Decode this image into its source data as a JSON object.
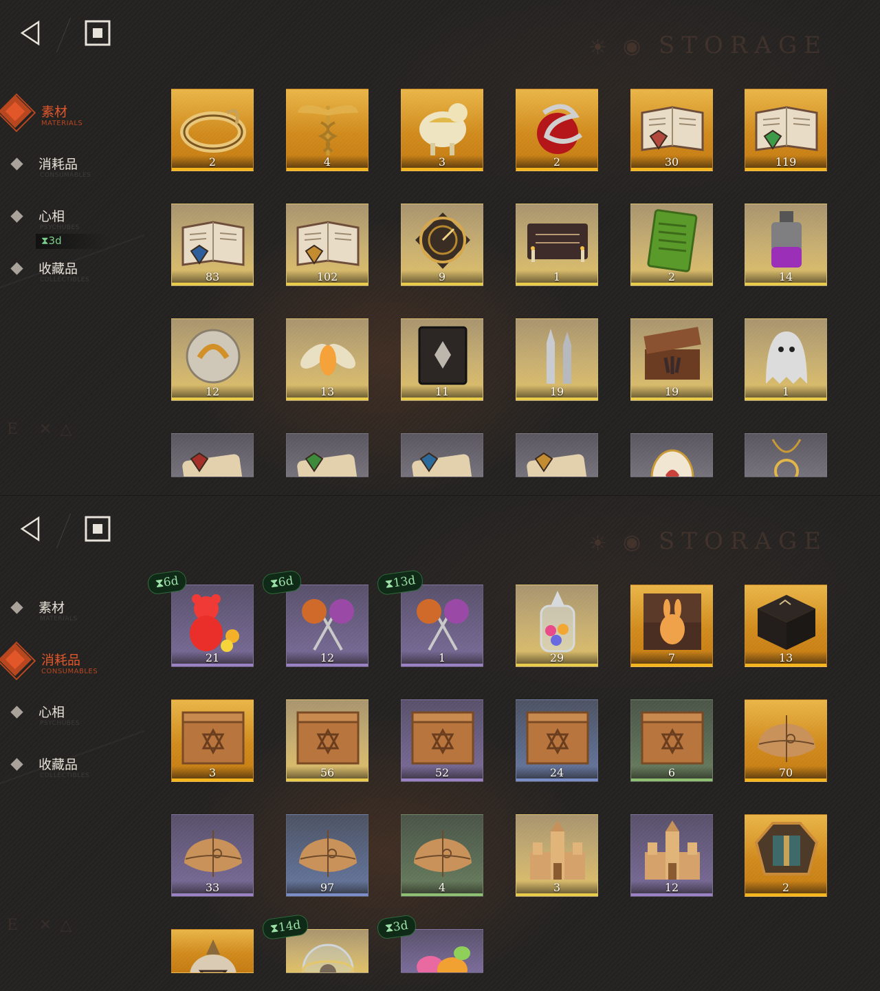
{
  "screens": [
    {
      "watermark": "STORAGE",
      "nav": [
        {
          "label": "素材",
          "sub": "MATERIALS",
          "active": true
        },
        {
          "label": "消耗品",
          "sub": "CONSUMABLES",
          "active": false,
          "timer": "⧗3d"
        },
        {
          "label": "心相",
          "sub": "PSYCHUBES",
          "active": false
        },
        {
          "label": "收藏品",
          "sub": "COLLECTIBLES",
          "active": false
        }
      ],
      "items": [
        {
          "icon": "gold-ring-icon",
          "count": "2",
          "rarity": "orange"
        },
        {
          "icon": "caduceus-icon",
          "count": "4",
          "rarity": "orange"
        },
        {
          "icon": "gilded-sheep-icon",
          "count": "3",
          "rarity": "orange"
        },
        {
          "icon": "snake-apple-icon",
          "count": "2",
          "rarity": "orange"
        },
        {
          "icon": "red-rune-book-icon",
          "count": "30",
          "rarity": "orange"
        },
        {
          "icon": "green-rune-book-icon",
          "count": "119",
          "rarity": "orange"
        },
        {
          "icon": "blue-rune-book-icon",
          "count": "83",
          "rarity": "gold"
        },
        {
          "icon": "gold-rune-book-icon",
          "count": "102",
          "rarity": "gold"
        },
        {
          "icon": "astrolabe-icon",
          "count": "9",
          "rarity": "gold"
        },
        {
          "icon": "ouija-board-icon",
          "count": "1",
          "rarity": "gold"
        },
        {
          "icon": "green-tablet-icon",
          "count": "2",
          "rarity": "gold"
        },
        {
          "icon": "potion-bottle-icon",
          "count": "14",
          "rarity": "gold"
        },
        {
          "icon": "metal-puzzle-ball-icon",
          "count": "12",
          "rarity": "gold"
        },
        {
          "icon": "firefly-icon",
          "count": "13",
          "rarity": "gold"
        },
        {
          "icon": "dark-tome-icon",
          "count": "11",
          "rarity": "gold"
        },
        {
          "icon": "silver-bullets-icon",
          "count": "19",
          "rarity": "gold"
        },
        {
          "icon": "hand-chest-icon",
          "count": "19",
          "rarity": "gold"
        },
        {
          "icon": "ghost-icon",
          "count": "1",
          "rarity": "gold"
        },
        {
          "icon": "red-scroll-icon",
          "count": "",
          "rarity": "grey"
        },
        {
          "icon": "green-scroll-icon",
          "count": "",
          "rarity": "grey"
        },
        {
          "icon": "blue-scroll-icon",
          "count": "",
          "rarity": "grey"
        },
        {
          "icon": "gold-scroll-icon",
          "count": "",
          "rarity": "grey"
        },
        {
          "icon": "jeweled-egg-icon",
          "count": "",
          "rarity": "grey"
        },
        {
          "icon": "pendant-necklace-icon",
          "count": "",
          "rarity": "grey"
        }
      ]
    },
    {
      "watermark": "STORAGE",
      "nav": [
        {
          "label": "素材",
          "sub": "MATERIALS",
          "active": false
        },
        {
          "label": "消耗品",
          "sub": "CONSUMABLES",
          "active": true
        },
        {
          "label": "心相",
          "sub": "PSYCHUBES",
          "active": false
        },
        {
          "label": "收藏品",
          "sub": "COLLECTIBLES",
          "active": false
        }
      ],
      "items": [
        {
          "icon": "gummy-bear-icon",
          "count": "21",
          "rarity": "purple",
          "timer": "⧗6d"
        },
        {
          "icon": "lollipops-icon",
          "count": "12",
          "rarity": "purple",
          "timer": "⧗6d"
        },
        {
          "icon": "lollipops-icon",
          "count": "1",
          "rarity": "purple",
          "timer": "⧗13d"
        },
        {
          "icon": "candy-jar-icon",
          "count": "29",
          "rarity": "gold"
        },
        {
          "icon": "rabbit-box-icon",
          "count": "7",
          "rarity": "orange"
        },
        {
          "icon": "rune-box-icon",
          "count": "13",
          "rarity": "orange"
        },
        {
          "icon": "wooden-crate-icon",
          "count": "3",
          "rarity": "orange"
        },
        {
          "icon": "wooden-crate-icon",
          "count": "56",
          "rarity": "gold"
        },
        {
          "icon": "wooden-crate-icon",
          "count": "52",
          "rarity": "purple"
        },
        {
          "icon": "wooden-crate-icon",
          "count": "24",
          "rarity": "blue"
        },
        {
          "icon": "wooden-crate-icon",
          "count": "6",
          "rarity": "green"
        },
        {
          "icon": "parcel-icon",
          "count": "70",
          "rarity": "orange"
        },
        {
          "icon": "parcel-icon",
          "count": "33",
          "rarity": "purple"
        },
        {
          "icon": "parcel-icon",
          "count": "97",
          "rarity": "blue"
        },
        {
          "icon": "parcel-icon",
          "count": "4",
          "rarity": "green"
        },
        {
          "icon": "castle-icon",
          "count": "3",
          "rarity": "gold"
        },
        {
          "icon": "castle-icon",
          "count": "12",
          "rarity": "purple"
        },
        {
          "icon": "mosaic-tile-icon",
          "count": "2",
          "rarity": "orange"
        },
        {
          "icon": "pouch-icon",
          "count": "",
          "rarity": "orange"
        },
        {
          "icon": "glass-globe-icon",
          "count": "",
          "rarity": "gold",
          "timer": "⧗14d"
        },
        {
          "icon": "wrapped-candies-icon",
          "count": "",
          "rarity": "purple",
          "timer": "⧗3d"
        }
      ]
    }
  ]
}
